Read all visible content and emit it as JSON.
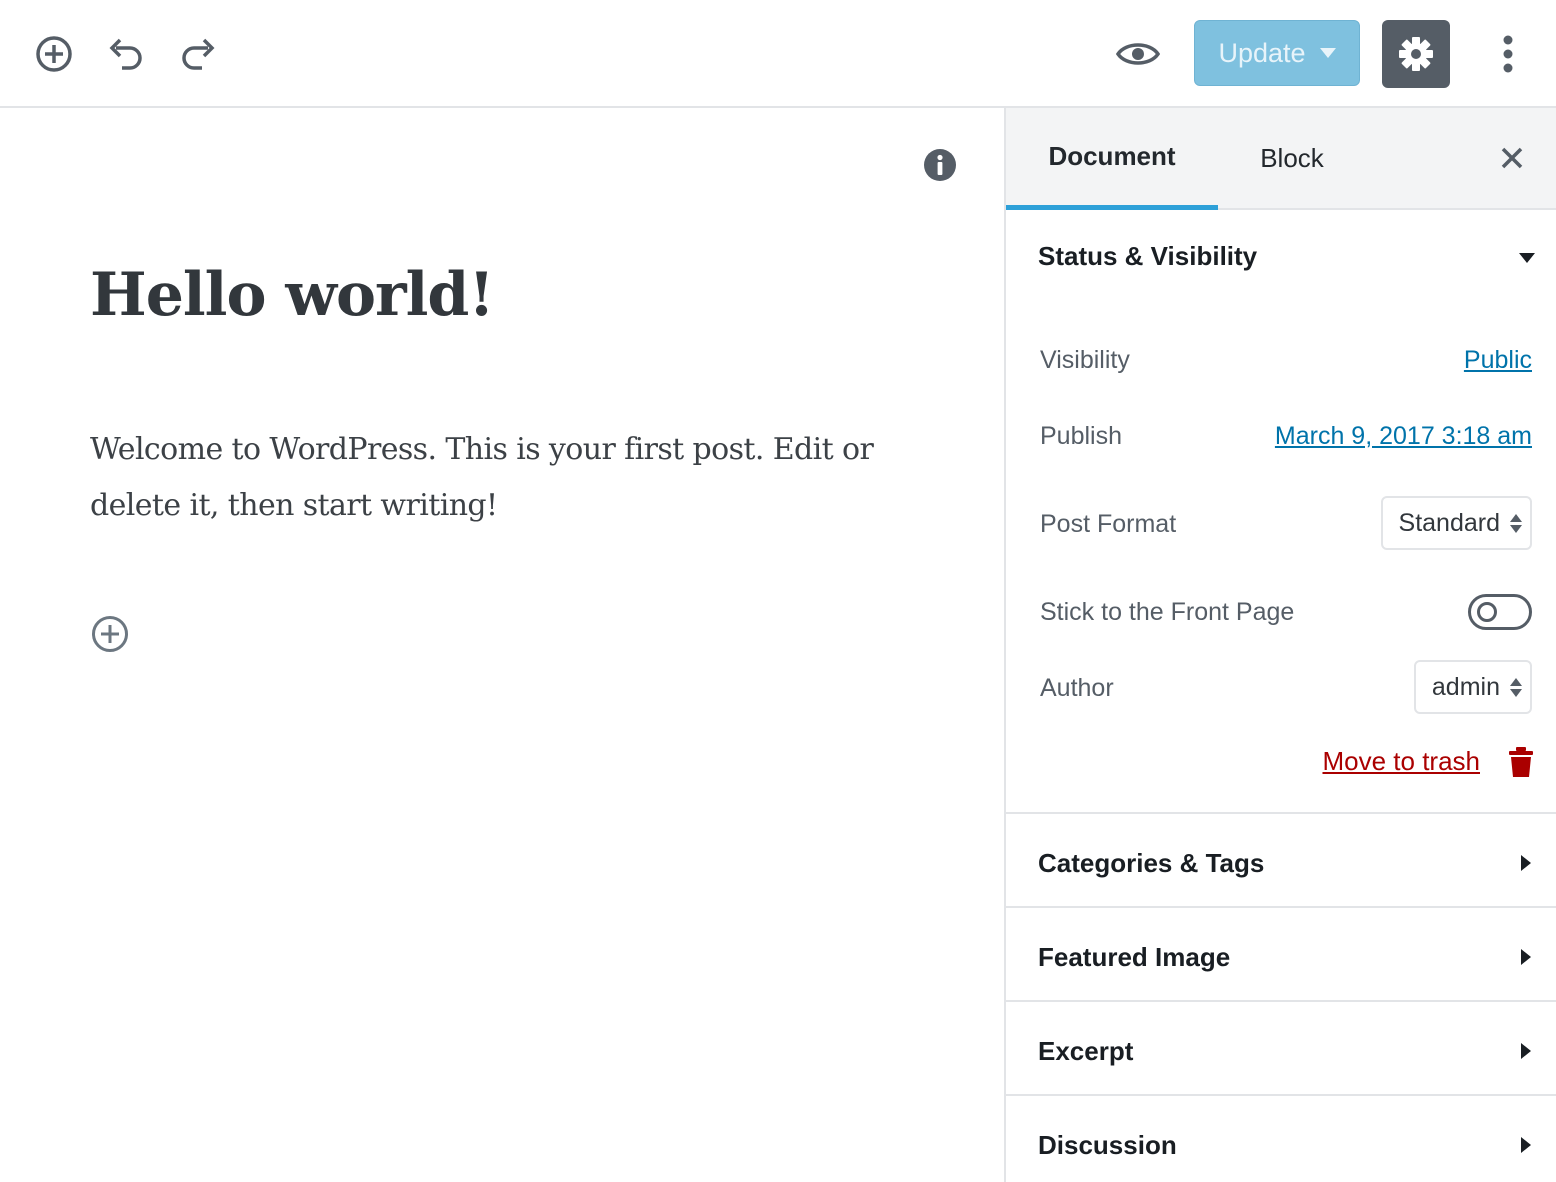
{
  "toolbar": {
    "add_block_icon": "plus-circle-icon",
    "undo_icon": "undo-icon",
    "redo_icon": "redo-icon",
    "preview_icon": "eye-icon",
    "update_label": "Update",
    "settings_icon": "gear-icon",
    "more_icon": "more-vertical-icon"
  },
  "editor": {
    "title": "Hello world!",
    "body": "Welcome to WordPress. This is your first post. Edit or delete it, then start writing!"
  },
  "sidebar": {
    "tabs": [
      {
        "label": "Document",
        "active": true
      },
      {
        "label": "Block",
        "active": false
      }
    ],
    "status_visibility": {
      "title": "Status & Visibility",
      "expanded": true,
      "visibility_label": "Visibility",
      "visibility_value": "Public",
      "publish_label": "Publish",
      "publish_value": "March 9, 2017 3:18 am",
      "post_format_label": "Post Format",
      "post_format_value": "Standard",
      "sticky_label": "Stick to the Front Page",
      "sticky_on": false,
      "author_label": "Author",
      "author_value": "admin",
      "trash_label": "Move to trash"
    },
    "panels": [
      {
        "title": "Categories & Tags",
        "expanded": false
      },
      {
        "title": "Featured Image",
        "expanded": false
      },
      {
        "title": "Excerpt",
        "expanded": false
      },
      {
        "title": "Discussion",
        "expanded": false
      }
    ]
  },
  "colors": {
    "accent": "#2da0d8",
    "update_button": "#7fc1df",
    "settings_button": "#555d66",
    "link": "#0073aa",
    "danger": "#aa0000"
  }
}
